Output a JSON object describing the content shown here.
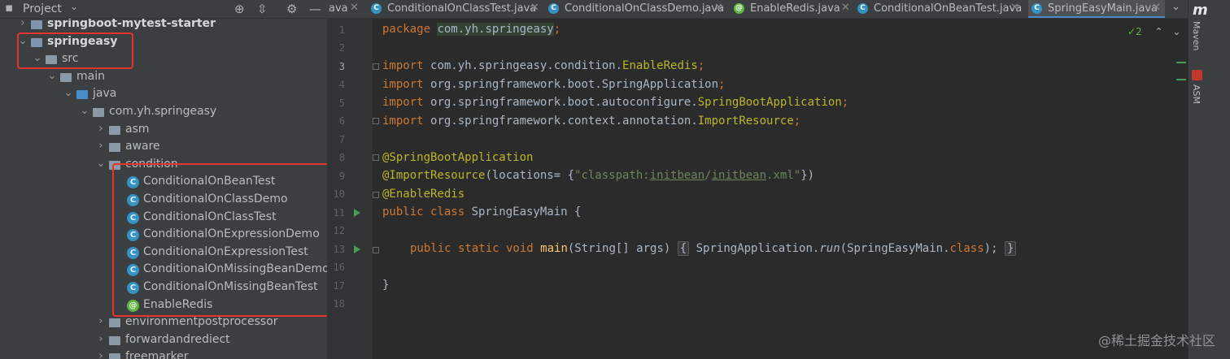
{
  "project_panel": {
    "title": "Project",
    "tree": [
      {
        "label": "springboot-mytest-starter",
        "arrow": "›",
        "icon": "module-folder"
      },
      {
        "label": "springeasy",
        "arrow": "⌄",
        "icon": "module-folder"
      },
      {
        "label": "src",
        "arrow": "⌄",
        "icon": "folder"
      },
      {
        "label": "main",
        "arrow": "⌄",
        "icon": "folder"
      },
      {
        "label": "java",
        "arrow": "⌄",
        "icon": "source-folder"
      },
      {
        "label": "com.yh.springeasy",
        "arrow": "⌄",
        "icon": "package"
      },
      {
        "label": "asm",
        "arrow": "›",
        "icon": "package"
      },
      {
        "label": "aware",
        "arrow": "›",
        "icon": "package"
      },
      {
        "label": "condition",
        "arrow": "⌄",
        "icon": "package"
      },
      {
        "label": "ConditionalOnBeanTest",
        "icon": "class"
      },
      {
        "label": "ConditionalOnClassDemo",
        "icon": "class"
      },
      {
        "label": "ConditionalOnClassTest",
        "icon": "class"
      },
      {
        "label": "ConditionalOnExpressionDemo",
        "icon": "class"
      },
      {
        "label": "ConditionalOnExpressionTest",
        "icon": "class"
      },
      {
        "label": "ConditionalOnMissingBeanDemo",
        "icon": "class"
      },
      {
        "label": "ConditionalOnMissingBeanTest",
        "icon": "class"
      },
      {
        "label": "EnableRedis",
        "icon": "annotation"
      },
      {
        "label": "environmentpostprocessor",
        "arrow": "›",
        "icon": "package"
      },
      {
        "label": "forwardandrediect",
        "arrow": "›",
        "icon": "package"
      },
      {
        "label": "freemarker",
        "arrow": "›",
        "icon": "package"
      }
    ]
  },
  "tabs": [
    {
      "label": "ava",
      "icon": ""
    },
    {
      "label": "ConditionalOnClassTest.java",
      "icon": "class"
    },
    {
      "label": "ConditionalOnClassDemo.java",
      "icon": "class"
    },
    {
      "label": "EnableRedis.java",
      "icon": "annotation"
    },
    {
      "label": "ConditionalOnBeanTest.java",
      "icon": "class"
    },
    {
      "label": "SpringEasyMain.java",
      "icon": "class"
    }
  ],
  "editor": {
    "line_numbers": [
      "1",
      "2",
      "3",
      "4",
      "5",
      "6",
      "7",
      "8",
      "9",
      "10",
      "11",
      "12",
      "13",
      "16",
      "17",
      "18"
    ],
    "current_line": "3",
    "inspection_count": "✓2"
  },
  "code": {
    "l1_kw": "package ",
    "l1_pkg": "com.yh.springeasy",
    "l1_end": ";",
    "l3_kw": "import ",
    "l3_a": "com.yh.springeasy.condition.",
    "l3_b": "EnableRedis",
    "l3_end": ";",
    "l4_kw": "import ",
    "l4_a": "org.springframework.boot.SpringApplication",
    "l4_end": ";",
    "l5_kw": "import ",
    "l5_a": "org.springframework.boot.autoconfigure.",
    "l5_b": "SpringBootApplication",
    "l5_end": ";",
    "l6_kw": "import ",
    "l6_a": "org.springframework.context.annotation.",
    "l6_b": "ImportResource",
    "l6_end": ";",
    "l8_ann": "@SpringBootApplication",
    "l9_ann": "@ImportResource",
    "l9_a": "(locations= {",
    "l9_s1": "\"classpath:",
    "l9_s2": "initbean",
    "l9_s3": "/",
    "l9_s4": "initbean",
    "l9_s5": ".xml\"",
    "l9_end": "})",
    "l10_ann": "@EnableRedis",
    "l11_kw": "public class ",
    "l11_name": "SpringEasyMain {",
    "l13_kw": "public static void ",
    "l13_fn": "main",
    "l13_a": "(String[] args)",
    "l13_b": "{",
    "l13_c": "SpringApplication.",
    "l13_run": "run",
    "l13_d": "(SpringEasyMain.",
    "l13_kw2": "class",
    "l13_e": ");",
    "l13_f": "}",
    "l17": "}"
  },
  "right_strip": {
    "maven_logo": "m",
    "maven_label": "Maven",
    "asm_label": "ASM"
  },
  "watermark": "@稀土掘金技术社区",
  "colors": {
    "keyword": "#cc7832",
    "annotation": "#bbb529",
    "string": "#6a8759",
    "method": "#ffc66d",
    "highlight_box": "#e0362b",
    "class_icon": "#3592c4",
    "annotation_icon": "#62b543"
  }
}
